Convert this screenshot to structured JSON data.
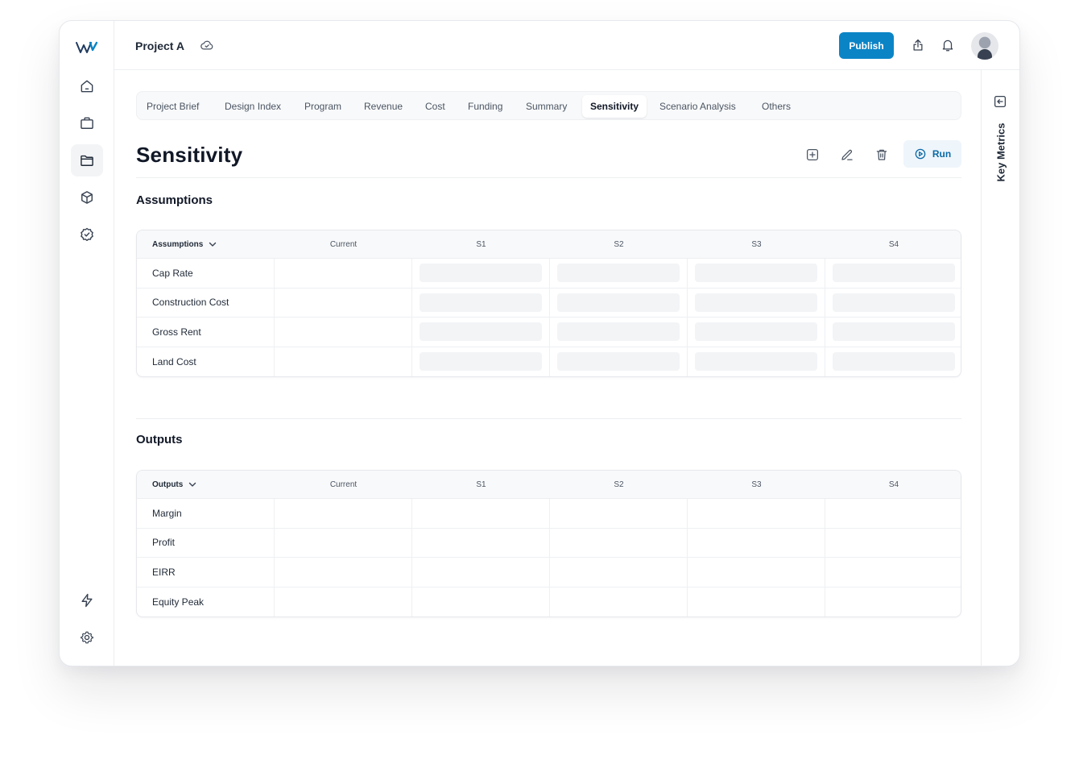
{
  "header": {
    "project_title": "Project A",
    "publish_label": "Publish"
  },
  "tabs": [
    {
      "label": "Project Brief",
      "active": false
    },
    {
      "label": "Design Index",
      "active": false
    },
    {
      "label": "Program",
      "active": false
    },
    {
      "label": "Revenue",
      "active": false
    },
    {
      "label": "Cost",
      "active": false
    },
    {
      "label": "Funding",
      "active": false
    },
    {
      "label": "Summary",
      "active": false
    },
    {
      "label": "Sensitivity",
      "active": true
    },
    {
      "label": "Scenario Analysis",
      "active": false
    },
    {
      "label": "Others",
      "active": false
    }
  ],
  "page": {
    "title": "Sensitivity",
    "run_label": "Run"
  },
  "right_panel": {
    "label": "Key Metrics"
  },
  "assumptions": {
    "section_title": "Assumptions",
    "columns": [
      "Assumptions",
      "Current",
      "S1",
      "S2",
      "S3",
      "S4"
    ],
    "rows": [
      "Cap Rate",
      "Construction Cost",
      "Gross Rent",
      "Land Cost"
    ]
  },
  "outputs": {
    "section_title": "Outputs",
    "columns": [
      "Outputs",
      "Current",
      "S1",
      "S2",
      "S3",
      "S4"
    ],
    "rows": [
      "Margin",
      "Profit",
      "EIRR",
      "Equity Peak"
    ]
  },
  "colors": {
    "accent": "#0b84c6",
    "run_background": "#eef5fb",
    "input_placeholder": "#f3f4f6"
  },
  "icons": {
    "sidebar": [
      "home-icon",
      "briefcase-icon",
      "folder-icon",
      "cube-icon",
      "badge-check-icon",
      "lightning-icon",
      "gear-icon"
    ],
    "header": [
      "cloud-check-icon",
      "share-icon",
      "bell-icon"
    ],
    "actions": [
      "add-icon",
      "edit-icon",
      "trash-icon",
      "play-circle-icon"
    ]
  }
}
